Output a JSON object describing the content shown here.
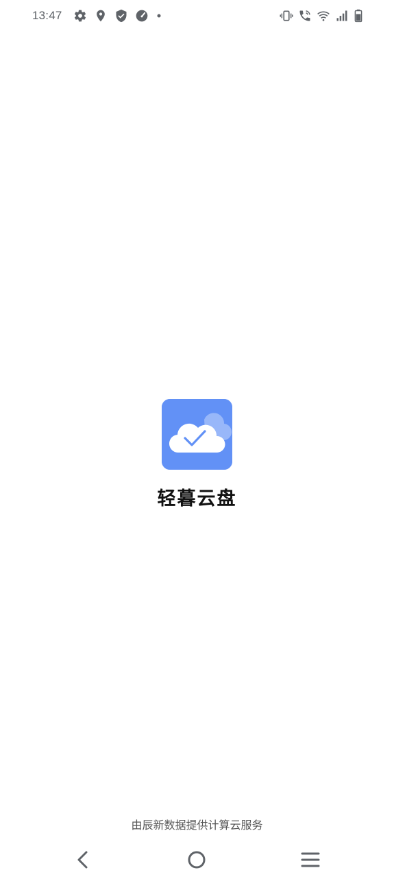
{
  "status_bar": {
    "time": "13:47",
    "left_icons": [
      "gear-icon",
      "location-pin-icon",
      "shield-icon",
      "speedometer-icon",
      "dot-icon"
    ],
    "right_icons": [
      "vibrate-icon",
      "wifi-calling-icon",
      "wifi-icon",
      "signal-icon",
      "battery-icon"
    ]
  },
  "splash": {
    "app_name": "轻暮云盘",
    "logo_icon": "cloud-check-icon",
    "logo_color": "#6291f6",
    "provider_text": "由辰新数据提供计算云服务"
  },
  "nav_bar": {
    "back_icon": "back-chevron-icon",
    "home_icon": "home-circle-icon",
    "recents_icon": "menu-lines-icon"
  }
}
